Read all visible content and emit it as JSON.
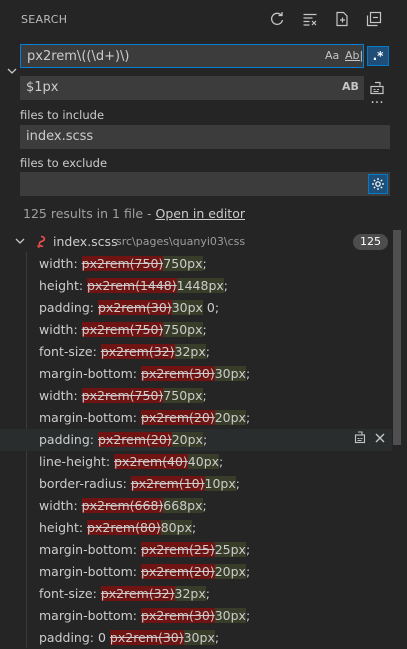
{
  "panel": {
    "title": "SEARCH"
  },
  "search": {
    "query": "px2rem\\((\\d+)\\)",
    "opts": {
      "match_case": "Aa",
      "whole_word": "Ab|",
      "regex": ".*"
    }
  },
  "replace": {
    "value": "$1px",
    "preserve_case": "AB"
  },
  "include": {
    "label": "files to include",
    "value": "index.scss"
  },
  "exclude": {
    "label": "files to exclude",
    "value": ""
  },
  "summary": {
    "text": "125 results in 1 file - ",
    "link": "Open in editor"
  },
  "file": {
    "name": "index.scss",
    "path": "src\\pages\\quanyi03\\css",
    "count": "125"
  },
  "matches": [
    {
      "prop": "width:",
      "pre": " ",
      "del": "px2rem(750)",
      "ins": "750px",
      "post": ";"
    },
    {
      "prop": "height:",
      "pre": " ",
      "del": "px2rem(1448)",
      "ins": "1448px",
      "post": ";"
    },
    {
      "prop": "padding:",
      "pre": " ",
      "del": "px2rem(30)",
      "ins": "30px",
      "post": " 0;"
    },
    {
      "prop": "width:",
      "pre": " ",
      "del": "px2rem(750)",
      "ins": "750px",
      "post": ";"
    },
    {
      "prop": "font-size:",
      "pre": " ",
      "del": "px2rem(32)",
      "ins": "32px",
      "post": ";"
    },
    {
      "prop": "margin-bottom:",
      "pre": " ",
      "del": "px2rem(30)",
      "ins": "30px",
      "post": ";"
    },
    {
      "prop": "width:",
      "pre": " ",
      "del": "px2rem(750)",
      "ins": "750px",
      "post": ";"
    },
    {
      "prop": "margin-bottom:",
      "pre": " ",
      "del": "px2rem(20)",
      "ins": "20px",
      "post": ";"
    },
    {
      "prop": "padding:",
      "pre": " ",
      "del": "px2rem(20)",
      "ins": "20px",
      "post": ";"
    },
    {
      "prop": "line-height:",
      "pre": " ",
      "del": "px2rem(40)",
      "ins": "40px",
      "post": ";"
    },
    {
      "prop": "border-radius:",
      "pre": " ",
      "del": "px2rem(10)",
      "ins": "10px",
      "post": ";"
    },
    {
      "prop": "width:",
      "pre": " ",
      "del": "px2rem(668)",
      "ins": "668px",
      "post": ";"
    },
    {
      "prop": "height:",
      "pre": " ",
      "del": "px2rem(80)",
      "ins": "80px",
      "post": ";"
    },
    {
      "prop": "margin-bottom:",
      "pre": " ",
      "del": "px2rem(25)",
      "ins": "25px",
      "post": ";"
    },
    {
      "prop": "margin-bottom:",
      "pre": " ",
      "del": "px2rem(20)",
      "ins": "20px",
      "post": ";"
    },
    {
      "prop": "font-size:",
      "pre": " ",
      "del": "px2rem(32)",
      "ins": "32px",
      "post": ";"
    },
    {
      "prop": "margin-bottom:",
      "pre": " ",
      "del": "px2rem(30)",
      "ins": "30px",
      "post": ";"
    },
    {
      "prop": "padding:",
      "pre": " 0 ",
      "del": "px2rem(30)",
      "ins": "30px",
      "post": ";"
    }
  ],
  "colors": {
    "background": "#252526",
    "input": "#3c3c3c",
    "focus": "#007fd4",
    "deleted": "#6f1313",
    "inserted": "#373d29",
    "file_icon": "#f14c4c"
  }
}
